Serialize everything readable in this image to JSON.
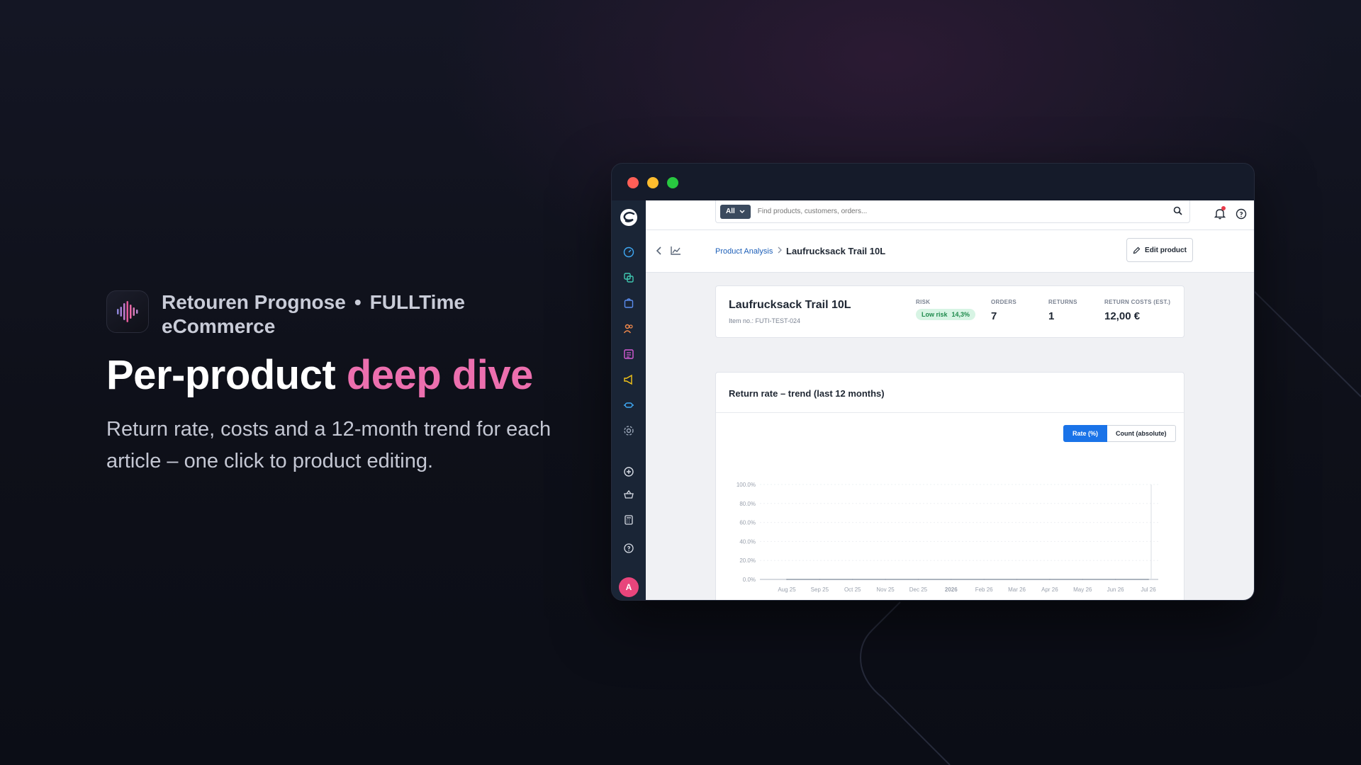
{
  "hero": {
    "app_name": "Retouren Prognose",
    "separator": "•",
    "company": "FULLTime eCommerce",
    "headline_plain": "Per-product ",
    "headline_accent": "deep dive",
    "subtitle": "Return rate, costs and a 12-month trend for each article – one click to product editing.",
    "accent_color": "#ec6fae"
  },
  "topbar": {
    "filter_label": "All",
    "search_placeholder": "Find products, customers, orders..."
  },
  "breadcrumb": {
    "parent": "Product Analysis",
    "current": "Laufrucksack Trail 10L"
  },
  "toolbar": {
    "edit_label": "Edit product"
  },
  "summary": {
    "name": "Laufrucksack Trail 10L",
    "item_no": "Item no.: FUTI-TEST-024",
    "risk_label": "RISK",
    "risk_badge": "Low risk",
    "risk_value": "14,3%",
    "orders_label": "ORDERS",
    "orders_value": "7",
    "returns_label": "RETURNS",
    "returns_value": "1",
    "costs_label": "RETURN COSTS (EST.)",
    "costs_value": "12,00 €"
  },
  "trend": {
    "title": "Return rate – trend (last 12 months)",
    "toggle_rate": "Rate (%)",
    "toggle_count": "Count (absolute)",
    "active_toggle": "Rate (%)"
  },
  "user": {
    "avatar_initial": "A"
  },
  "sidebar_icons": [
    "dashboard-icon",
    "copy-icon",
    "bag-icon",
    "users-icon",
    "list-icon",
    "megaphone-icon",
    "plugin-icon",
    "settings-icon",
    "plus-circle-icon",
    "basket-icon",
    "calculator-icon",
    "help-icon"
  ],
  "chart_data": {
    "type": "line",
    "title": "Return rate – trend (last 12 months)",
    "categories": [
      "Aug 25",
      "Sep 25",
      "Oct 25",
      "Nov 25",
      "Dec 25",
      "2026",
      "Feb 26",
      "Mar 26",
      "Apr 26",
      "May 26",
      "Jun 26",
      "Jul 26"
    ],
    "y_ticks": [
      "0.0%",
      "20.0%",
      "40.0%",
      "60.0%",
      "80.0%",
      "100.0%"
    ],
    "ylim": [
      0,
      100
    ],
    "series": [
      {
        "values": [
          0,
          0,
          0,
          0,
          0,
          0,
          0,
          0,
          0,
          0,
          0,
          0
        ]
      }
    ],
    "grid": true
  }
}
